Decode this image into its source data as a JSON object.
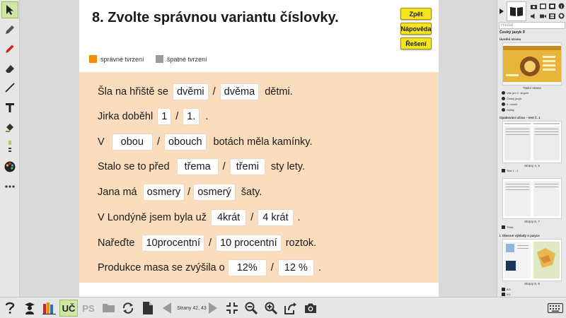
{
  "exercise": {
    "title": "8. Zvolte správnou variantu číslovky.",
    "buttons": {
      "check": "Zpět",
      "hint": "Nápověda",
      "solution": "Řešení"
    },
    "legend": {
      "correct": {
        "label": "správné tvrzení",
        "color": "#f28c00"
      },
      "wrong": {
        "label": "špatné tvrzení",
        "color": "#9b9b9b"
      }
    },
    "rows": [
      {
        "before": "Šla na hřiště se",
        "opt1": "dvěmi",
        "opt2": "dvěma",
        "after": "dětmi."
      },
      {
        "before": "Jirka doběhl",
        "opt1": "1",
        "opt2": "1.",
        "after": "."
      },
      {
        "before": "V",
        "opt1": "obou",
        "opt2": "obouch",
        "after": "botách měla kamínky."
      },
      {
        "before": "Stalo se to před",
        "opt1": "třema",
        "opt2": "třemi",
        "after": "sty lety."
      },
      {
        "before": "Jana má",
        "opt1": "osmery",
        "opt2": "osmerý",
        "after": "šaty."
      },
      {
        "before": "V Londýně jsem byla už",
        "opt1": "4krát",
        "opt2": "4 krát",
        "after": "."
      },
      {
        "before": "Nařeďte",
        "opt1": "10procentní",
        "opt2": "10 procentní",
        "after": "roztok."
      },
      {
        "before": "Produkce masa se zvýšila o",
        "opt1": "12%",
        "opt2": "12 %",
        "after": "."
      }
    ],
    "background_color": "#fbdcbd"
  },
  "right_panel": {
    "search_placeholder": "Hledat",
    "book_title": "Český jazyk 9",
    "sections": [
      {
        "title": "Úvodní strana",
        "caption": "Titulní strana",
        "links": [
          "Vše pro 2. stupeň",
          "Český jazyk",
          "9. ročník",
          "Sešity"
        ]
      },
      {
        "title": "Opakování učiva – test č. 1",
        "caption": "Strany 4, 5",
        "links": [
          "Test 1 - 1"
        ]
      },
      {
        "title": "",
        "caption": "Strany 6, 7",
        "links": [
          "Třída"
        ]
      },
      {
        "title": "I. Obecné výklady o jazyce",
        "caption": "Strany 8, 9",
        "links": [
          "8/3",
          "9/1"
        ]
      }
    ]
  },
  "bottombar": {
    "uc_label": "UČ",
    "ps_label": "PS",
    "page_indicator": "Strany 42, 43"
  },
  "colors": {
    "accent_green": "#cfe6a6",
    "button_yellow": "#f6e41e"
  }
}
